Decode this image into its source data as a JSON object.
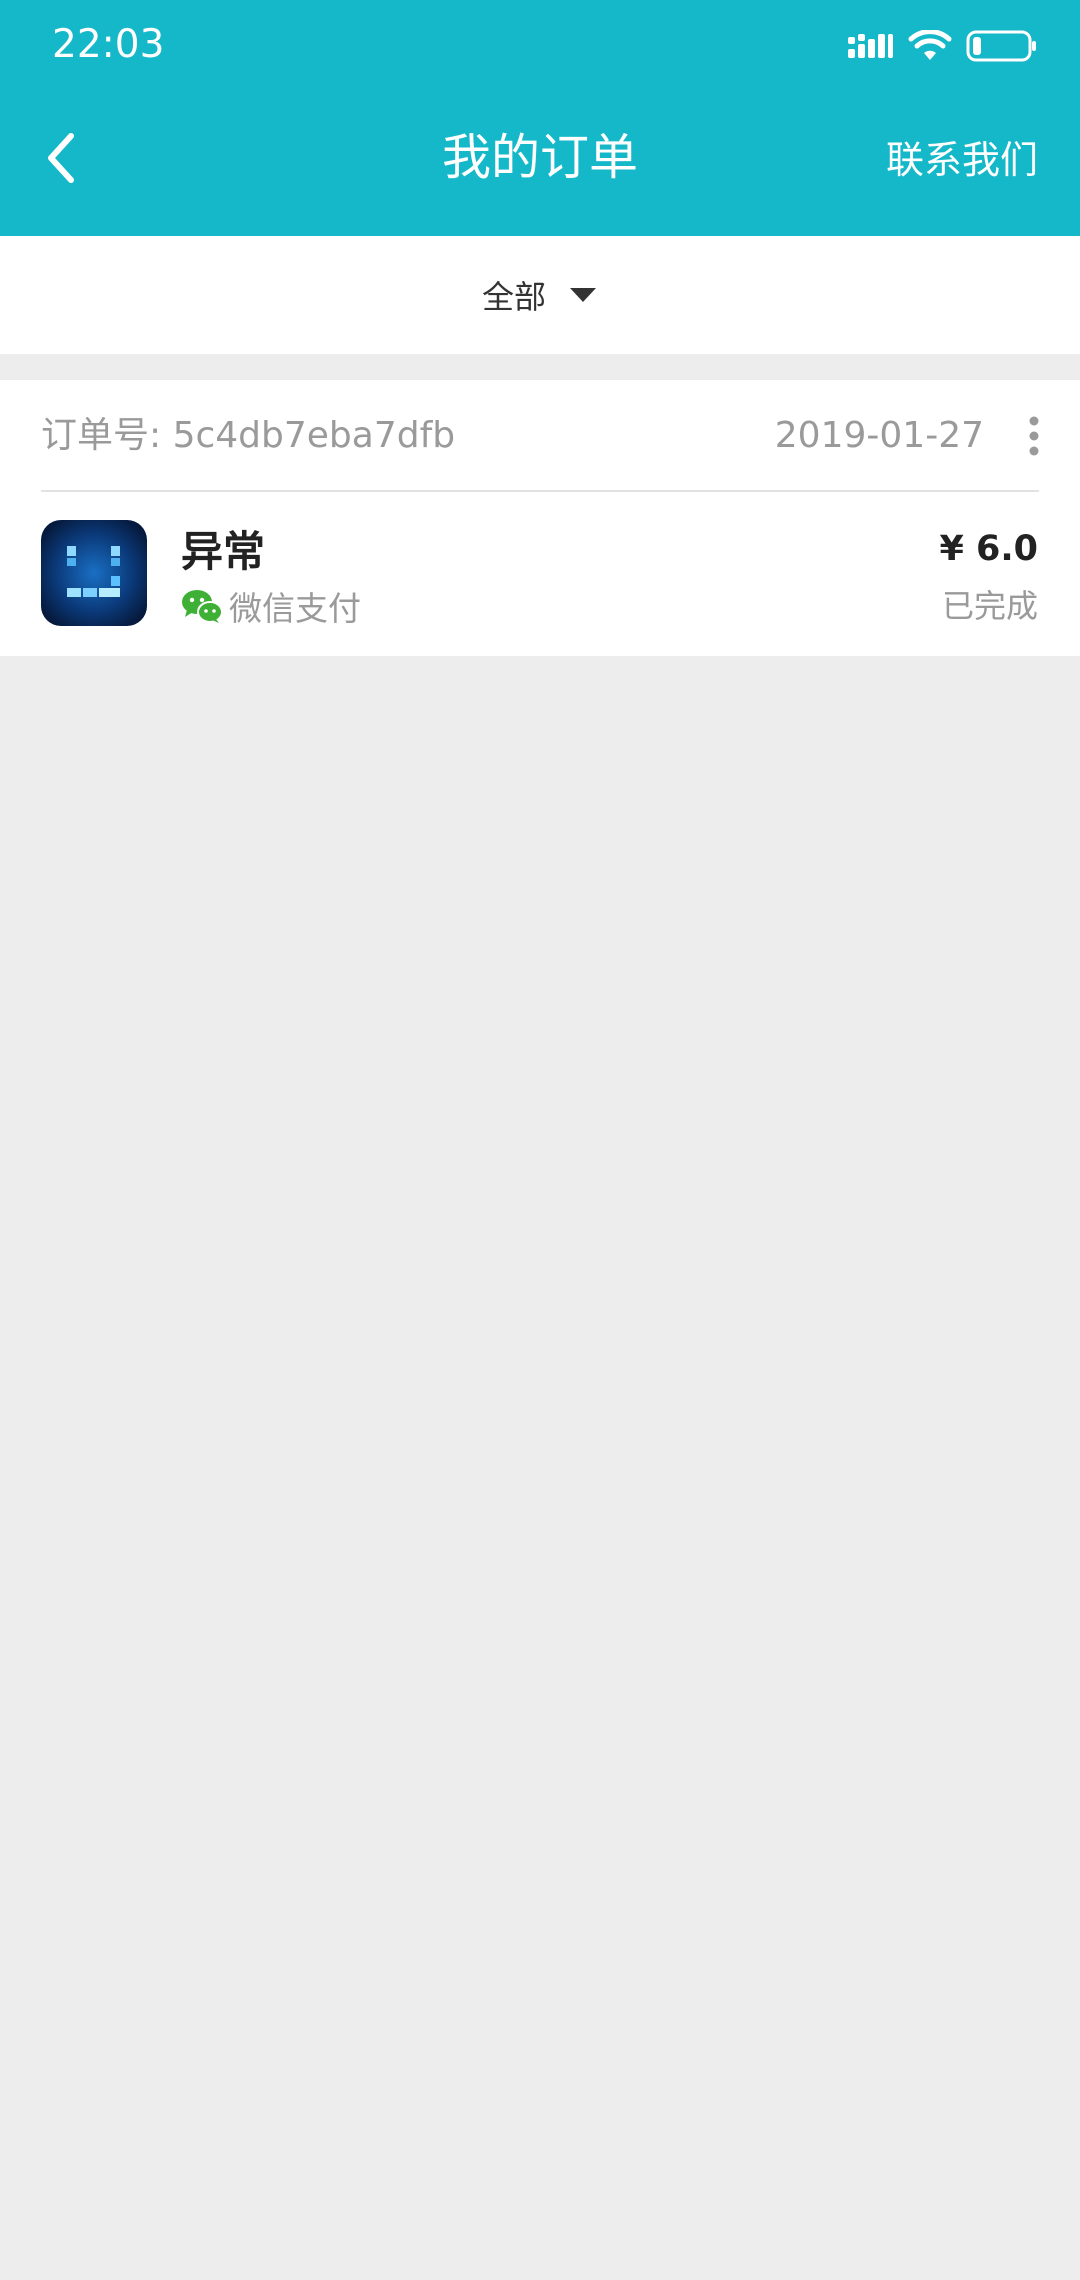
{
  "status_bar": {
    "time": "22:03"
  },
  "header": {
    "title": "我的订单",
    "back_icon": "chevron-left-icon",
    "contact_label": "联系我们"
  },
  "filter": {
    "selected": "全部",
    "icon": "caret-down-icon"
  },
  "orders": [
    {
      "order_number": "订单号: 5c4db7eba7dfb",
      "date": "2019-01-27",
      "product_name": "异常",
      "payment_method": "微信支付",
      "payment_icon": "wechat-icon",
      "price": "¥ 6.0",
      "status": "已完成"
    }
  ],
  "colors": {
    "header_bg": "#15b8c9",
    "page_bg": "#ededed",
    "wechat_green": "#3eb035"
  }
}
